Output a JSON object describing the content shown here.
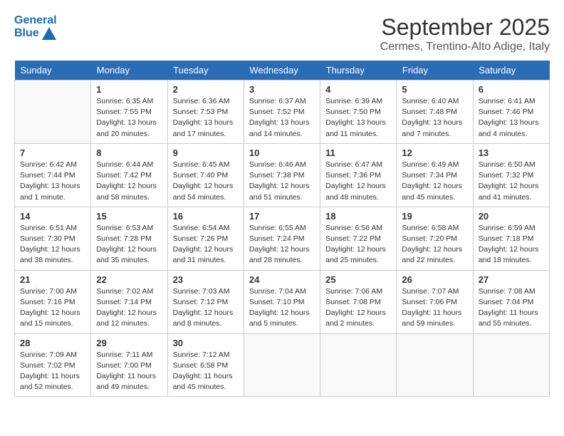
{
  "logo": {
    "line1": "General",
    "line2": "Blue"
  },
  "title": "September 2025",
  "subtitle": "Cermes, Trentino-Alto Adige, Italy",
  "weekdays": [
    "Sunday",
    "Monday",
    "Tuesday",
    "Wednesday",
    "Thursday",
    "Friday",
    "Saturday"
  ],
  "weeks": [
    [
      {
        "day": null
      },
      {
        "day": "1",
        "sunrise": "6:35 AM",
        "sunset": "7:55 PM",
        "daylight": "13 hours and 20 minutes."
      },
      {
        "day": "2",
        "sunrise": "6:36 AM",
        "sunset": "7:53 PM",
        "daylight": "13 hours and 17 minutes."
      },
      {
        "day": "3",
        "sunrise": "6:37 AM",
        "sunset": "7:52 PM",
        "daylight": "13 hours and 14 minutes."
      },
      {
        "day": "4",
        "sunrise": "6:39 AM",
        "sunset": "7:50 PM",
        "daylight": "13 hours and 11 minutes."
      },
      {
        "day": "5",
        "sunrise": "6:40 AM",
        "sunset": "7:48 PM",
        "daylight": "13 hours and 7 minutes."
      },
      {
        "day": "6",
        "sunrise": "6:41 AM",
        "sunset": "7:46 PM",
        "daylight": "13 hours and 4 minutes."
      }
    ],
    [
      {
        "day": "7",
        "sunrise": "6:42 AM",
        "sunset": "7:44 PM",
        "daylight": "13 hours and 1 minute."
      },
      {
        "day": "8",
        "sunrise": "6:44 AM",
        "sunset": "7:42 PM",
        "daylight": "12 hours and 58 minutes."
      },
      {
        "day": "9",
        "sunrise": "6:45 AM",
        "sunset": "7:40 PM",
        "daylight": "12 hours and 54 minutes."
      },
      {
        "day": "10",
        "sunrise": "6:46 AM",
        "sunset": "7:38 PM",
        "daylight": "12 hours and 51 minutes."
      },
      {
        "day": "11",
        "sunrise": "6:47 AM",
        "sunset": "7:36 PM",
        "daylight": "12 hours and 48 minutes."
      },
      {
        "day": "12",
        "sunrise": "6:49 AM",
        "sunset": "7:34 PM",
        "daylight": "12 hours and 45 minutes."
      },
      {
        "day": "13",
        "sunrise": "6:50 AM",
        "sunset": "7:32 PM",
        "daylight": "12 hours and 41 minutes."
      }
    ],
    [
      {
        "day": "14",
        "sunrise": "6:51 AM",
        "sunset": "7:30 PM",
        "daylight": "12 hours and 38 minutes."
      },
      {
        "day": "15",
        "sunrise": "6:53 AM",
        "sunset": "7:28 PM",
        "daylight": "12 hours and 35 minutes."
      },
      {
        "day": "16",
        "sunrise": "6:54 AM",
        "sunset": "7:26 PM",
        "daylight": "12 hours and 31 minutes."
      },
      {
        "day": "17",
        "sunrise": "6:55 AM",
        "sunset": "7:24 PM",
        "daylight": "12 hours and 28 minutes."
      },
      {
        "day": "18",
        "sunrise": "6:56 AM",
        "sunset": "7:22 PM",
        "daylight": "12 hours and 25 minutes."
      },
      {
        "day": "19",
        "sunrise": "6:58 AM",
        "sunset": "7:20 PM",
        "daylight": "12 hours and 22 minutes."
      },
      {
        "day": "20",
        "sunrise": "6:59 AM",
        "sunset": "7:18 PM",
        "daylight": "12 hours and 18 minutes."
      }
    ],
    [
      {
        "day": "21",
        "sunrise": "7:00 AM",
        "sunset": "7:16 PM",
        "daylight": "12 hours and 15 minutes."
      },
      {
        "day": "22",
        "sunrise": "7:02 AM",
        "sunset": "7:14 PM",
        "daylight": "12 hours and 12 minutes."
      },
      {
        "day": "23",
        "sunrise": "7:03 AM",
        "sunset": "7:12 PM",
        "daylight": "12 hours and 8 minutes."
      },
      {
        "day": "24",
        "sunrise": "7:04 AM",
        "sunset": "7:10 PM",
        "daylight": "12 hours and 5 minutes."
      },
      {
        "day": "25",
        "sunrise": "7:06 AM",
        "sunset": "7:08 PM",
        "daylight": "12 hours and 2 minutes."
      },
      {
        "day": "26",
        "sunrise": "7:07 AM",
        "sunset": "7:06 PM",
        "daylight": "11 hours and 59 minutes."
      },
      {
        "day": "27",
        "sunrise": "7:08 AM",
        "sunset": "7:04 PM",
        "daylight": "11 hours and 55 minutes."
      }
    ],
    [
      {
        "day": "28",
        "sunrise": "7:09 AM",
        "sunset": "7:02 PM",
        "daylight": "11 hours and 52 minutes."
      },
      {
        "day": "29",
        "sunrise": "7:11 AM",
        "sunset": "7:00 PM",
        "daylight": "11 hours and 49 minutes."
      },
      {
        "day": "30",
        "sunrise": "7:12 AM",
        "sunset": "6:58 PM",
        "daylight": "11 hours and 45 minutes."
      },
      {
        "day": null
      },
      {
        "day": null
      },
      {
        "day": null
      },
      {
        "day": null
      }
    ]
  ]
}
